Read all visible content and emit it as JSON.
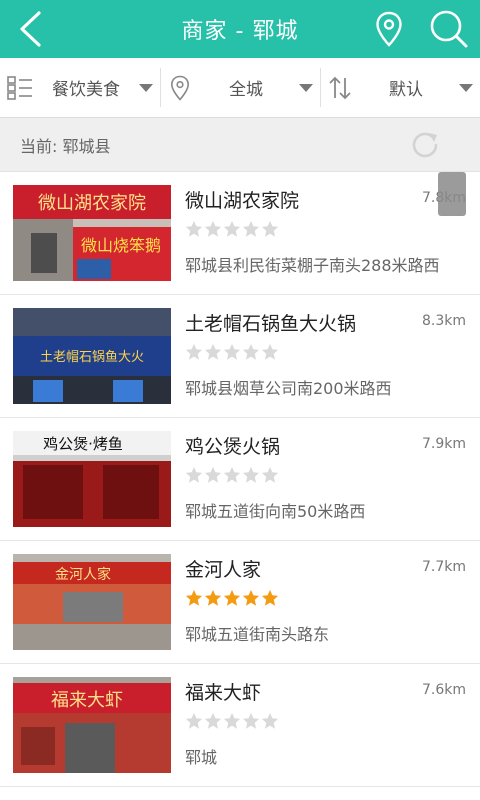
{
  "header": {
    "title": "商家 - 郓城",
    "back_icon": "back-arrow-icon",
    "location_icon": "location-pin-icon",
    "search_icon": "search-icon",
    "color": "#27c0a9"
  },
  "filters": [
    {
      "label": "餐饮美食",
      "icon": "category-list-icon"
    },
    {
      "label": "全城",
      "icon": "location-pin-icon"
    },
    {
      "label": "默认",
      "icon": "sort-icon"
    }
  ],
  "current": {
    "text": "当前: 郓城县",
    "refresh_icon": "refresh-icon"
  },
  "items": [
    {
      "name": "微山湖农家院",
      "distance": "7.8km",
      "rating": 0,
      "address": "郓城县利民街菜棚子南头288米路西",
      "sign_text": "微山湖农家院",
      "sub_sign": "微山烧笨鹅"
    },
    {
      "name": "土老帽石锅鱼大火锅",
      "distance": "8.3km",
      "rating": 0,
      "address": "郓城县烟草公司南200米路西",
      "sign_text": "土老帽石锅鱼大火"
    },
    {
      "name": "鸡公煲火锅",
      "distance": "7.9km",
      "rating": 0,
      "address": "郓城五道街向南50米路西",
      "sign_text": "鸡公煲·烤鱼"
    },
    {
      "name": "金河人家",
      "distance": "7.7km",
      "rating": 5,
      "address": "郓城五道街南头路东",
      "sign_text": "金河人家"
    },
    {
      "name": "福来大虾",
      "distance": "7.6km",
      "rating": 0,
      "address": "郓城",
      "sign_text": "福来大虾"
    }
  ],
  "colors": {
    "accent": "#27c0a9",
    "star_filled": "#f39c12",
    "star_empty": "#d9d9d9"
  }
}
